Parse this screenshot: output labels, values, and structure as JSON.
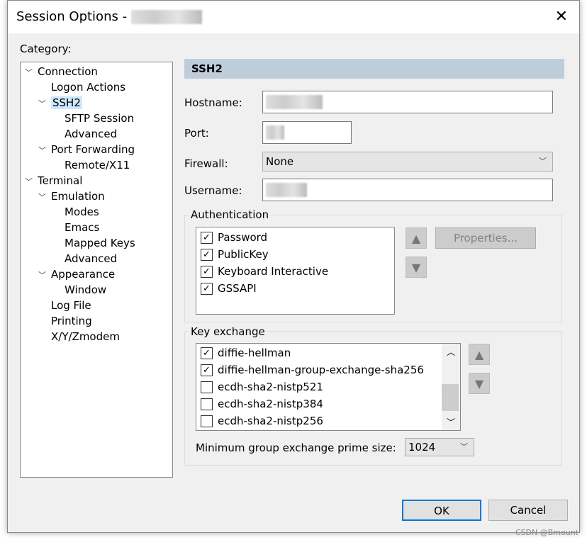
{
  "window": {
    "title": "Session Options - ",
    "close": "✕"
  },
  "category_label": "Category:",
  "tree": [
    {
      "label": "Connection",
      "level": 0,
      "expanded": true
    },
    {
      "label": "Logon Actions",
      "level": 1
    },
    {
      "label": "SSH2",
      "level": 1,
      "expanded": true,
      "selected": true
    },
    {
      "label": "SFTP Session",
      "level": 2
    },
    {
      "label": "Advanced",
      "level": 2
    },
    {
      "label": "Port Forwarding",
      "level": 1,
      "expanded": true
    },
    {
      "label": "Remote/X11",
      "level": 2
    },
    {
      "label": "Terminal",
      "level": 0,
      "expanded": true
    },
    {
      "label": "Emulation",
      "level": 1,
      "expanded": true
    },
    {
      "label": "Modes",
      "level": 2
    },
    {
      "label": "Emacs",
      "level": 2
    },
    {
      "label": "Mapped Keys",
      "level": 2
    },
    {
      "label": "Advanced",
      "level": 2
    },
    {
      "label": "Appearance",
      "level": 1,
      "expanded": true
    },
    {
      "label": "Window",
      "level": 2
    },
    {
      "label": "Log File",
      "level": 1
    },
    {
      "label": "Printing",
      "level": 1
    },
    {
      "label": "X/Y/Zmodem",
      "level": 1
    }
  ],
  "panel": {
    "header": "SSH2",
    "hostname_label": "Hostname:",
    "port_label": "Port:",
    "firewall_label": "Firewall:",
    "firewall_value": "None",
    "username_label": "Username:",
    "auth_label": "Authentication",
    "auth": [
      {
        "label": "Password",
        "checked": true
      },
      {
        "label": "PublicKey",
        "checked": true
      },
      {
        "label": "Keyboard Interactive",
        "checked": true
      },
      {
        "label": "GSSAPI",
        "checked": true
      }
    ],
    "properties": "Properties...",
    "kex_label": "Key exchange",
    "kex": [
      {
        "label": "diffie-hellman",
        "checked": true
      },
      {
        "label": "diffie-hellman-group-exchange-sha256",
        "checked": true
      },
      {
        "label": "ecdh-sha2-nistp521",
        "checked": false
      },
      {
        "label": "ecdh-sha2-nistp384",
        "checked": false
      },
      {
        "label": "ecdh-sha2-nistp256",
        "checked": false
      }
    ],
    "min_group_label": "Minimum group exchange prime size:",
    "min_group_value": "1024"
  },
  "buttons": {
    "ok": "OK",
    "cancel": "Cancel"
  },
  "watermark": "CSDN @Bmount"
}
